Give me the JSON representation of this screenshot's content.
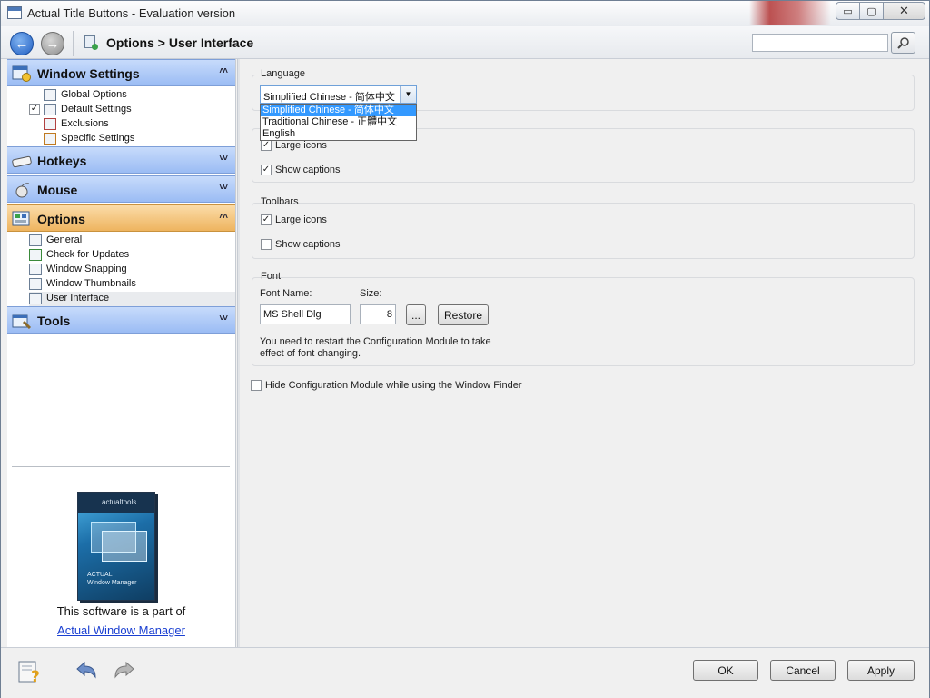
{
  "window": {
    "title": "Actual Title Buttons - Evaluation version",
    "minimize_glyph": "▭",
    "maximize_glyph": "▢",
    "close_glyph": "✕"
  },
  "nav": {
    "back_glyph": "←",
    "forward_glyph": "→",
    "breadcrumb": "Options > User Interface",
    "search_value": ""
  },
  "sidebar": {
    "groups": [
      {
        "label": "Window Settings",
        "chevron": "˄˄",
        "items": [
          {
            "label": "Global Options"
          },
          {
            "label": "Default Settings",
            "checked": "✓"
          },
          {
            "label": "Exclusions"
          },
          {
            "label": "Specific Settings"
          }
        ]
      },
      {
        "label": "Hotkeys",
        "chevron": "˅˅"
      },
      {
        "label": "Mouse",
        "chevron": "˅˅"
      },
      {
        "label": "Options",
        "chevron": "˄˄",
        "items": [
          {
            "label": "General"
          },
          {
            "label": "Check for Updates"
          },
          {
            "label": "Window Snapping"
          },
          {
            "label": "Window Thumbnails"
          },
          {
            "label": "User Interface"
          }
        ]
      },
      {
        "label": "Tools",
        "chevron": "˅˅"
      }
    ],
    "promo_text": "This software is a part of",
    "promo_link": "Actual Window Manager",
    "product_box": {
      "brand": "actualtools",
      "name_line1": "ACTUAL",
      "name_line2": "Window Manager"
    }
  },
  "main": {
    "language": {
      "label": "Language",
      "selected": "Simplified Chinese - 简体中文",
      "arrow": "▼",
      "options": [
        "Simplified Chinese - 简体中文",
        "Traditional Chinese - 正體中文",
        "English"
      ]
    },
    "sidebar_box": {
      "large_icons": "Large icons",
      "show_captions": "Show captions",
      "large_icons_check": "✓",
      "show_captions_check": "✓"
    },
    "toolbars": {
      "label": "Toolbars",
      "large_icons": "Large icons",
      "show_captions": "Show captions",
      "large_icons_check": "✓"
    },
    "font": {
      "label": "Font",
      "name_label": "Font Name:",
      "size_label": "Size:",
      "name_value": "MS Shell Dlg",
      "size_value": "8",
      "browse_label": "...",
      "restore_label": "Restore",
      "note": "You need to restart the Configuration Module to take effect of font changing."
    },
    "hide_config": "Hide Configuration Module while using the Window Finder"
  },
  "footer": {
    "ok": "OK",
    "cancel": "Cancel",
    "apply": "Apply"
  }
}
